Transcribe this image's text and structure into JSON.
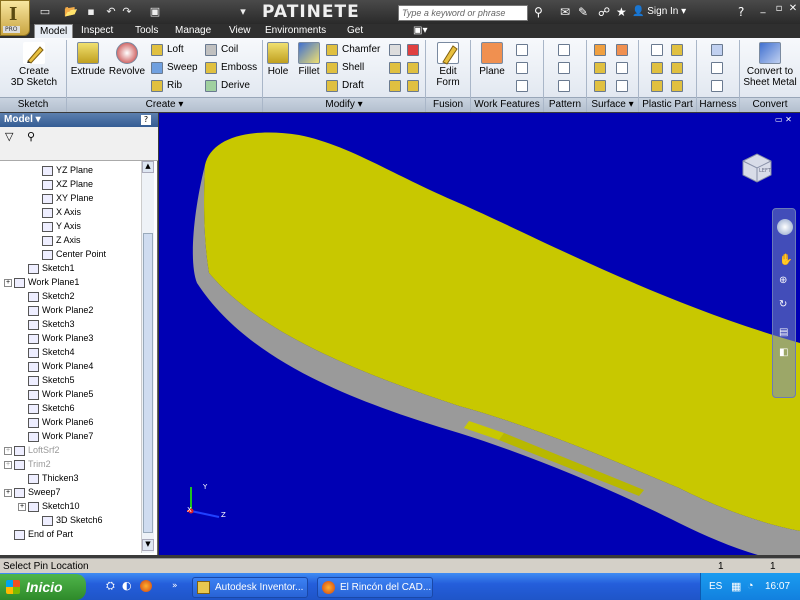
{
  "app": {
    "logo_letter": "I",
    "logo_badge": "PRO",
    "document_title": "PATINETE ...",
    "search_placeholder": "Type a keyword or phrase",
    "sign_in": "Sign In"
  },
  "menu_tabs": [
    "Model",
    "Inspect",
    "Tools",
    "Manage",
    "View",
    "Environments",
    "Get Started"
  ],
  "active_tab": "Model",
  "ribbon": {
    "sketch": {
      "create_3d_sketch": "Create\n3D Sketch",
      "panel": "Sketch"
    },
    "create": {
      "extrude": "Extrude",
      "revolve": "Revolve",
      "loft": "Loft",
      "sweep": "Sweep",
      "rib": "Rib",
      "coil": "Coil",
      "emboss": "Emboss",
      "derive": "Derive",
      "panel": "Create ▾"
    },
    "modify": {
      "hole": "Hole",
      "fillet": "Fillet",
      "chamfer": "Chamfer",
      "shell": "Shell",
      "draft": "Draft",
      "panel": "Modify ▾"
    },
    "fusion": {
      "edit_form": "Edit\nForm",
      "panel": "Fusion"
    },
    "work_features": {
      "plane": "Plane",
      "panel": "Work Features"
    },
    "pattern": {
      "panel": "Pattern"
    },
    "surface": {
      "panel": "Surface ▾"
    },
    "plastic_part": {
      "panel": "Plastic Part"
    },
    "harness": {
      "panel": "Harness"
    },
    "convert": {
      "convert": "Convert to\nSheet Metal",
      "panel": "Convert"
    }
  },
  "browser": {
    "title": "Model ▾",
    "help": "?",
    "items": [
      {
        "label": "YZ Plane",
        "indent": 2,
        "dim": false,
        "expander": false
      },
      {
        "label": "XZ Plane",
        "indent": 2,
        "dim": false,
        "expander": false
      },
      {
        "label": "XY Plane",
        "indent": 2,
        "dim": false,
        "expander": false
      },
      {
        "label": "X Axis",
        "indent": 2,
        "dim": false,
        "expander": false
      },
      {
        "label": "Y Axis",
        "indent": 2,
        "dim": false,
        "expander": false
      },
      {
        "label": "Z Axis",
        "indent": 2,
        "dim": false,
        "expander": false
      },
      {
        "label": "Center Point",
        "indent": 2,
        "dim": false,
        "expander": false
      },
      {
        "label": "Sketch1",
        "indent": 1,
        "dim": false,
        "expander": false
      },
      {
        "label": "Work Plane1",
        "indent": 0,
        "dim": false,
        "expander": true
      },
      {
        "label": "Sketch2",
        "indent": 1,
        "dim": false,
        "expander": false
      },
      {
        "label": "Work Plane2",
        "indent": 1,
        "dim": false,
        "expander": false
      },
      {
        "label": "Sketch3",
        "indent": 1,
        "dim": false,
        "expander": false
      },
      {
        "label": "Work Plane3",
        "indent": 1,
        "dim": false,
        "expander": false
      },
      {
        "label": "Sketch4",
        "indent": 1,
        "dim": false,
        "expander": false
      },
      {
        "label": "Work Plane4",
        "indent": 1,
        "dim": false,
        "expander": false
      },
      {
        "label": "Sketch5",
        "indent": 1,
        "dim": false,
        "expander": false
      },
      {
        "label": "Work Plane5",
        "indent": 1,
        "dim": false,
        "expander": false
      },
      {
        "label": "Sketch6",
        "indent": 1,
        "dim": false,
        "expander": false
      },
      {
        "label": "Work Plane6",
        "indent": 1,
        "dim": false,
        "expander": false
      },
      {
        "label": "Work Plane7",
        "indent": 1,
        "dim": false,
        "expander": false
      },
      {
        "label": "LoftSrf2",
        "indent": 0,
        "dim": true,
        "expander": true
      },
      {
        "label": "Trim2",
        "indent": 0,
        "dim": true,
        "expander": true
      },
      {
        "label": "Thicken3",
        "indent": 1,
        "dim": false,
        "expander": false
      },
      {
        "label": "Sweep7",
        "indent": 0,
        "dim": false,
        "expander": true
      },
      {
        "label": "Sketch10",
        "indent": 1,
        "dim": false,
        "expander": true
      },
      {
        "label": "3D Sketch6",
        "indent": 2,
        "dim": false,
        "expander": false
      },
      {
        "label": "End of Part",
        "indent": 0,
        "dim": false,
        "expander": false
      }
    ]
  },
  "viewcube_label": "LEFT",
  "triad": {
    "x": "X",
    "y": "Y",
    "z": "Z"
  },
  "status": {
    "text": "Select Pin Location",
    "count1": "1",
    "count2": "1"
  },
  "taskbar": {
    "start": "Inicio",
    "tasks": [
      "Autodesk Inventor...",
      "El Rincón del CAD..."
    ],
    "lang": "ES",
    "time": "16:07"
  },
  "colors": {
    "viewport_bg": "#0000b4",
    "part_face": "#c8c800",
    "part_edge": "#9a9a9a"
  }
}
